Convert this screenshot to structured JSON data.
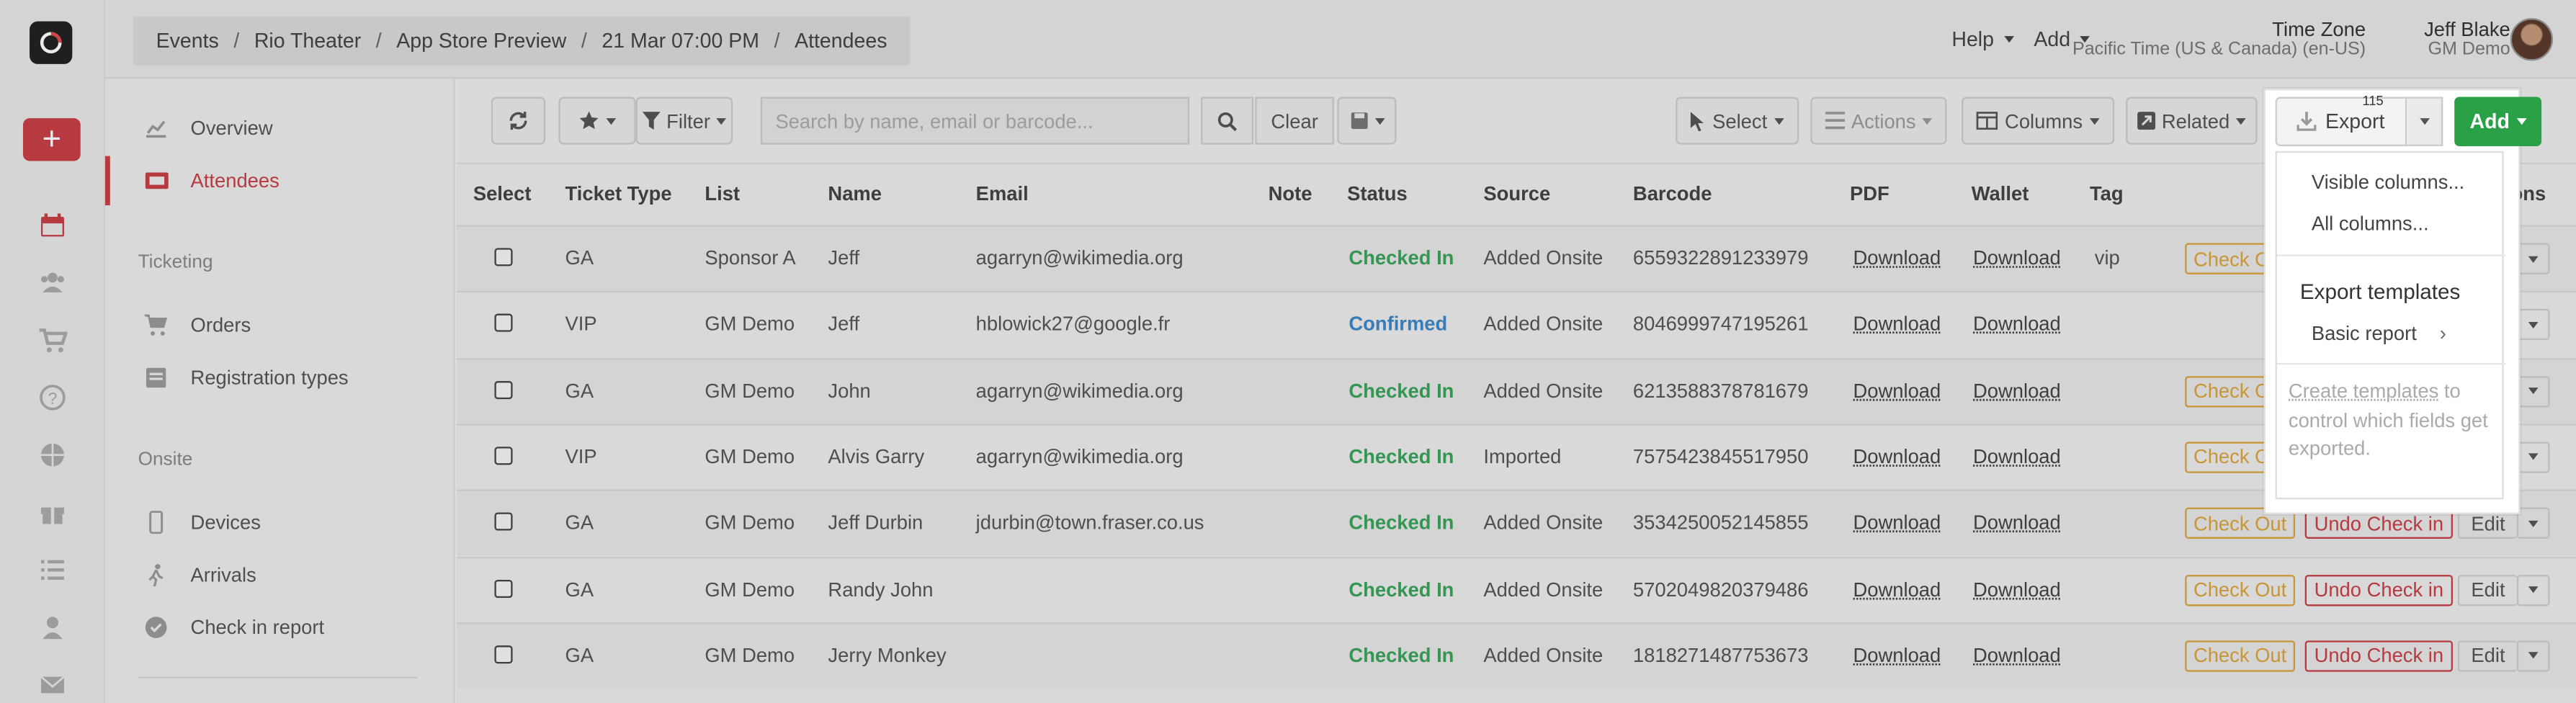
{
  "breadcrumbs": [
    "Events",
    "Rio Theater",
    "App Store Preview",
    "21 Mar 07:00 PM",
    "Attendees"
  ],
  "header": {
    "help_label": "Help",
    "add_label": "Add",
    "timezone_title": "Time Zone",
    "timezone_value": "Pacific Time (US & Canada) (en-US)",
    "user_name": "Jeff Blake",
    "user_org": "GM Demo"
  },
  "nav": {
    "overview": "Overview",
    "attendees": "Attendees",
    "ticketing_heading": "Ticketing",
    "orders": "Orders",
    "registration_types": "Registration types",
    "onsite_heading": "Onsite",
    "devices": "Devices",
    "arrivals": "Arrivals",
    "check_in_report": "Check in report"
  },
  "toolbar": {
    "filter_label": "Filter",
    "search_placeholder": "Search by name, email or barcode...",
    "clear_label": "Clear",
    "select_label": "Select",
    "actions_label": "Actions",
    "columns_label": "Columns",
    "related_label": "Related",
    "export_label": "Export",
    "export_count": "115",
    "add_label": "Add"
  },
  "table": {
    "headers": [
      "Select",
      "Ticket Type",
      "List",
      "Name",
      "Email",
      "Note",
      "Status",
      "Source",
      "Barcode",
      "PDF",
      "Wallet",
      "Tag",
      "Actions"
    ],
    "headers_visible_actions": "tions",
    "rows": [
      {
        "ticket": "GA",
        "list": "Sponsor A",
        "name": "Jeff",
        "email": "agarryn@wikimedia.org",
        "status": "Checked In",
        "source": "Added Onsite",
        "barcode": "6559322891233979",
        "pdf": "Download",
        "wallet": "Download",
        "tag": "vip"
      },
      {
        "ticket": "VIP",
        "list": "GM Demo",
        "name": "Jeff",
        "email": "hblowick27@google.fr",
        "status": "Confirmed",
        "source": "Added Onsite",
        "barcode": "8046999747195261",
        "pdf": "Download",
        "wallet": "Download",
        "tag": ""
      },
      {
        "ticket": "GA",
        "list": "GM Demo",
        "name": "John",
        "email": "agarryn@wikimedia.org",
        "status": "Checked In",
        "source": "Added Onsite",
        "barcode": "6213588378781679",
        "pdf": "Download",
        "wallet": "Download",
        "tag": ""
      },
      {
        "ticket": "VIP",
        "list": "GM Demo",
        "name": "Alvis Garry",
        "email": "agarryn@wikimedia.org",
        "status": "Checked In",
        "source": "Imported",
        "barcode": "7575423845517950",
        "pdf": "Download",
        "wallet": "Download",
        "tag": ""
      },
      {
        "ticket": "GA",
        "list": "GM Demo",
        "name": "Jeff Durbin",
        "email": "jdurbin@town.fraser.co.us",
        "status": "Checked In",
        "source": "Added Onsite",
        "barcode": "3534250052145855",
        "pdf": "Download",
        "wallet": "Download",
        "tag": ""
      },
      {
        "ticket": "GA",
        "list": "GM Demo",
        "name": "Randy John",
        "email": "",
        "status": "Checked In",
        "source": "Added Onsite",
        "barcode": "5702049820379486",
        "pdf": "Download",
        "wallet": "Download",
        "tag": ""
      },
      {
        "ticket": "GA",
        "list": "GM Demo",
        "name": "Jerry Monkey",
        "email": "",
        "status": "Checked In",
        "source": "Added Onsite",
        "barcode": "1818271487753673",
        "pdf": "Download",
        "wallet": "Download",
        "tag": ""
      }
    ],
    "row_actions": {
      "check_out": "Check Out",
      "undo_check_in": "Undo Check in",
      "edit": "Edit"
    }
  },
  "export_menu": {
    "visible_columns": "Visible columns...",
    "all_columns": "All columns...",
    "templates_heading": "Export templates",
    "basic_report": "Basic report",
    "help_link": "Create templates",
    "help_rest": " to control which fields get exported."
  },
  "colors": {
    "brand_red": "#c63f45",
    "checked_in_green": "#3aa35c",
    "confirmed_blue": "#3c87c6",
    "check_out_orange": "#d9a33b",
    "add_green": "#2aa147"
  }
}
